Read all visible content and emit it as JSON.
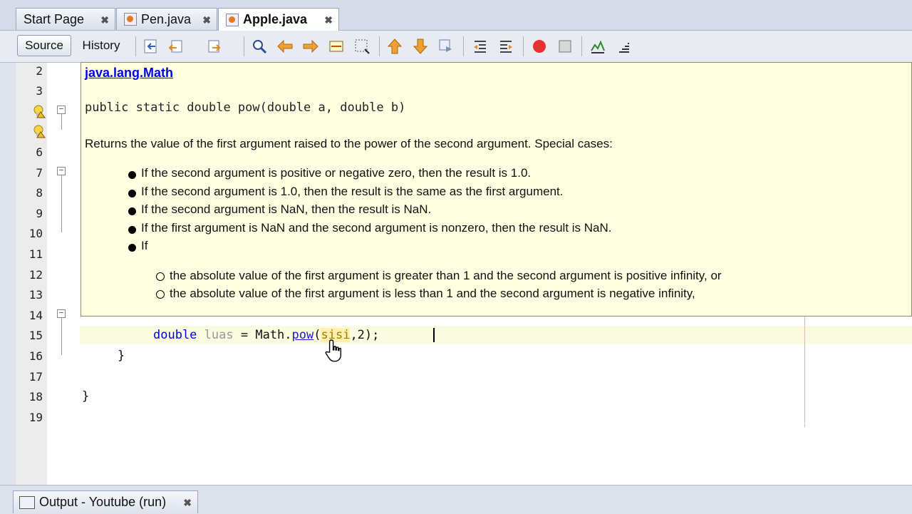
{
  "tabs": [
    {
      "label": "Start Page",
      "close": "✖"
    },
    {
      "label": "Pen.java",
      "close": "✖"
    },
    {
      "label": "Apple.java",
      "close": "✖",
      "active": true
    }
  ],
  "toolbar": {
    "source_label": "Source",
    "history_label": "History"
  },
  "line_numbers": [
    "2",
    "3",
    "4",
    "5",
    "6",
    "7",
    "8",
    "9",
    "10",
    "11",
    "12",
    "13",
    "14",
    "15",
    "16",
    "17",
    "18",
    "19"
  ],
  "code": {
    "l15_kw": "double",
    "l15_var": "luas",
    "l15_mid": " = Math.",
    "l15_meth": "pow",
    "l15_paren": "(",
    "l15_param": "sisi",
    "l15_end": ",2);",
    "l16": "}",
    "l18": "}"
  },
  "popup": {
    "link": "java.lang.Math",
    "signature": "public static double pow(double a, double b)",
    "description": "Returns the value of the first argument raised to the power of the second argument. Special cases:",
    "bullets": [
      "If the second argument is positive or negative zero, then the result is 1.0.",
      "If the second argument is 1.0, then the result is the same as the first argument.",
      "If the second argument is NaN, then the result is NaN.",
      "If the first argument is NaN and the second argument is nonzero, then the result is NaN.",
      "If"
    ],
    "sub_bullets": [
      "the absolute value of the first argument is greater than 1 and the second argument is positive infinity, or",
      "the absolute value of the first argument is less than 1 and the second argument is negative infinity,"
    ]
  },
  "output_tab": {
    "label": "Output - Youtube (run)",
    "close": "✖"
  },
  "colors": {
    "popup_bg": "#ffffe1",
    "keyword": "#0000e6",
    "link": "#0000ee"
  }
}
